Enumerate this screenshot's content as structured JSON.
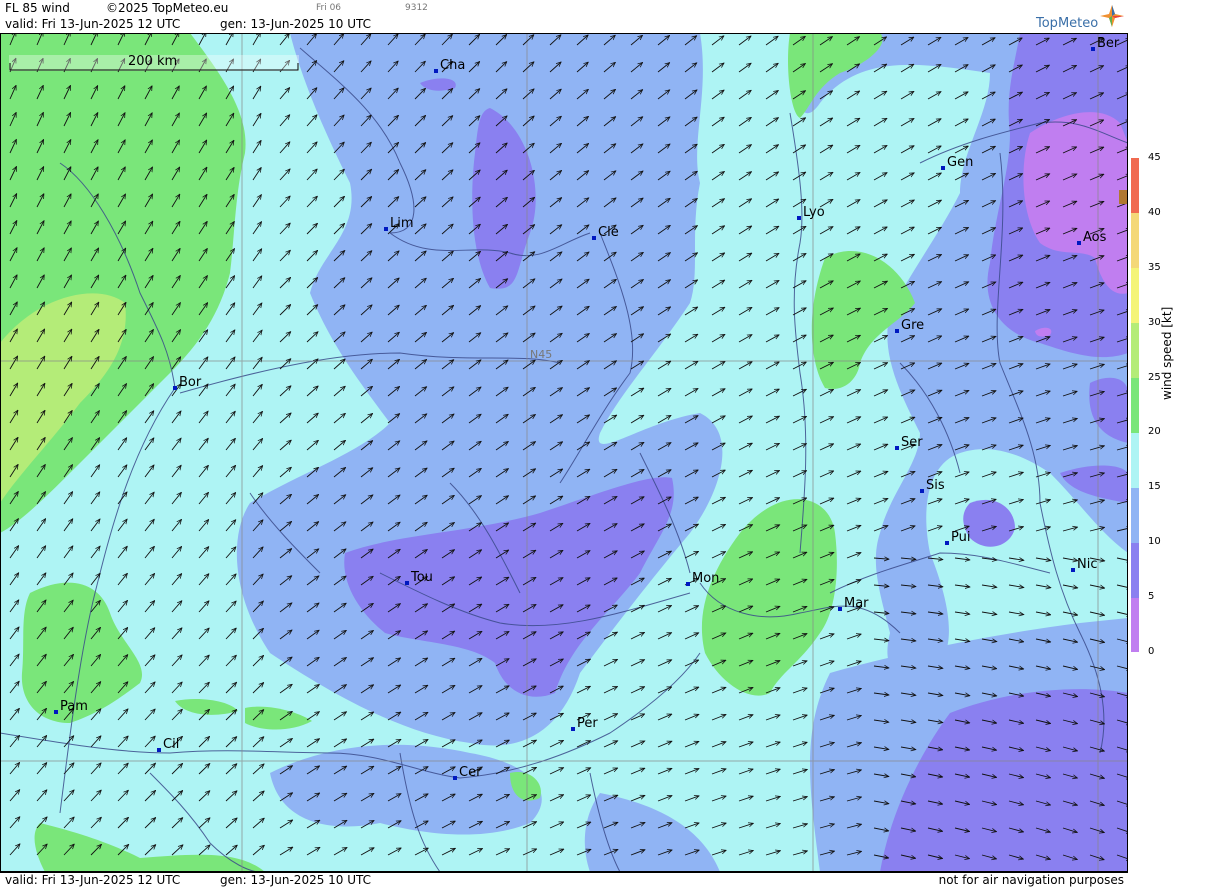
{
  "header": {
    "title": "FL 85 wind",
    "copyright": "©2025 TopMeteo.eu",
    "valid": "valid:  Fri  13-Jun-2025  12 UTC",
    "gen": "gen: 13-Jun-2025 10 UTC",
    "small_time": "Fri 06",
    "small_code": "9312"
  },
  "logo": {
    "text": "TopMeteo"
  },
  "map": {
    "scale_label": "200 km",
    "lat_label": "N45",
    "cities": [
      "Cha",
      "Ber",
      "Lim",
      "Cle",
      "Lyo",
      "Gen",
      "Aos",
      "Gre",
      "Bor",
      "Ser",
      "Sis",
      "Pui",
      "Tou",
      "Mon",
      "Mar",
      "Nic",
      "Pam",
      "Cil",
      "Per",
      "Cer"
    ]
  },
  "legend": {
    "unit_label": "wind speed [kt]",
    "ticks": [
      "45",
      "40",
      "35",
      "30",
      "25",
      "20",
      "15",
      "10",
      "5",
      "0"
    ],
    "colors": [
      "#c07ef0",
      "#8a80f0",
      "#90b4f4",
      "#aef4f4",
      "#7ae67a",
      "#b4ec78",
      "#f4f478",
      "#f4d878",
      "#f4a060",
      "#f06a50"
    ]
  },
  "footer": {
    "valid": "valid:  Fri  13-Jun-2025  12 UTC",
    "gen": "gen: 13-Jun-2025 10 UTC",
    "note": "not for air navigation purposes"
  }
}
